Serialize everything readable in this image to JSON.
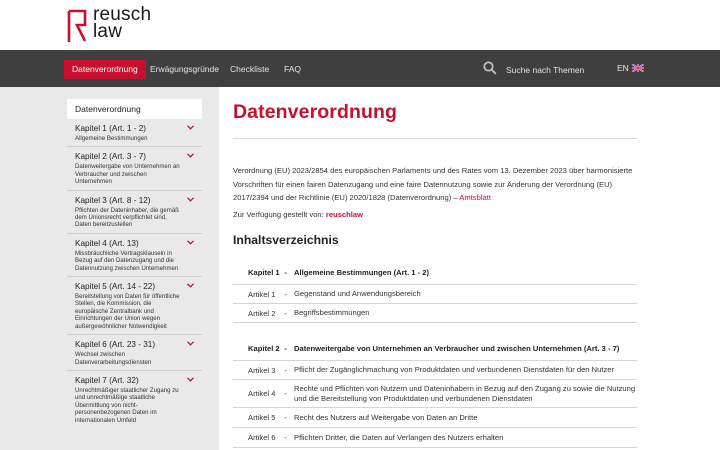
{
  "brand": {
    "line1": "reusch",
    "line2": "law",
    "color": "#c8102e"
  },
  "nav": {
    "items": [
      {
        "label": "Datenverordnung",
        "active": true
      },
      {
        "label": "Erwägungsgründe"
      },
      {
        "label": "Checkliste"
      },
      {
        "label": "FAQ"
      }
    ],
    "search_label": "Suche nach Themen",
    "lang": "EN"
  },
  "sidebar": {
    "top": "Datenverordnung",
    "items": [
      {
        "title": "Kapitel 1 (Art. 1 - 2)",
        "desc": "Allgemeine Bestimmungen"
      },
      {
        "title": "Kapitel 2 (Art. 3 - 7)",
        "desc": "Datenweitergabe von Unternehmen an Verbraucher und zwischen Unternehmen"
      },
      {
        "title": "Kapitel 3 (Art. 8 - 12)",
        "desc": "Pflichten der Dateninhaber, die gemäß dem Unionsrecht verpflichtet sind, Daten bereitzustellen"
      },
      {
        "title": "Kapitel 4 (Art. 13)",
        "desc": "Missbräuchliche Vertragsklauseln in Bezug auf den Datenzugang und die Datennutzung zwischen Unternehmen"
      },
      {
        "title": "Kapitel 5 (Art. 14 - 22)",
        "desc": "Bereitstellung von Daten für öffentliche Stellen, die Kommission, die europäische Zentralbank und Einrichtungen der Union wegen außergewöhnlicher Notwendigkeit"
      },
      {
        "title": "Kapitel 6  (Art. 23 - 31)",
        "desc": "Wechsel zwischen Datenverarbeitungsdiensten"
      },
      {
        "title": "Kapitel 7 (Art. 32)",
        "desc": "Unrechtmäßiger staatlicher Zugang zu und unrechtmäßige staatliche Übermittlung von nicht-personenbezogenen Daten im internationalen Umfeld"
      }
    ]
  },
  "main": {
    "title": "Datenverordnung",
    "intro": "Verordnung (EU) 2023/2854 des europäischen Parlaments und des Rates vom 13. Dezember 2023 über harmonisierte Vorschriften für einen fairen Datenzugang und eine faire Datennutzung sowie zur Änderung der Verordnung (EU) 2017/2394 und der Richtlinie (EU) 2020/1828 (Datenverordnung) –",
    "intro_link": "Amtsblatt",
    "provided_prefix": "Zur Verfügung gestellt von:",
    "provided_link": "reuschlaw",
    "toc_title": "Inhaltsverzeichnis",
    "toc": [
      {
        "num": "Kapitel 1",
        "sep": "-",
        "text": "Allgemeine Bestimmungen (Art. 1 - 2)",
        "chapter": true
      },
      {
        "num": "Artikel 1",
        "sep": "-",
        "text": "Gegenstand und Anwendungsbereich"
      },
      {
        "num": "Artikel 2",
        "sep": "-",
        "text": "Begriffsbestimmungen"
      },
      {
        "num": "Kapitel 2",
        "sep": "-",
        "text": "Datenweitergabe von Unternehmen an Verbraucher und zwischen Unternehmen (Art. 3 - 7)",
        "chapter": true
      },
      {
        "num": "Artikel 3",
        "sep": "-",
        "text": "Pflicht der Zugänglichmachung von Produktdaten und verbundenen Dienstdaten für den Nutzer"
      },
      {
        "num": "Artikel 4",
        "sep": "-",
        "text": "Rechte und Pflichten von Nutzern und Dateninhabern in Bezug auf den Zugang zu sowie die Nutzung und die Bereitstellung von Produktdaten und verbundenen Dienstdaten"
      },
      {
        "num": "Artikel 5",
        "sep": "-",
        "text": "Recht des Nutzers auf Weitergabe von Daten an Dritte"
      },
      {
        "num": "Artikel 6",
        "sep": "-",
        "text": "Pflichten Dritter, die Daten auf Verlangen des Nutzers erhalten"
      }
    ]
  }
}
